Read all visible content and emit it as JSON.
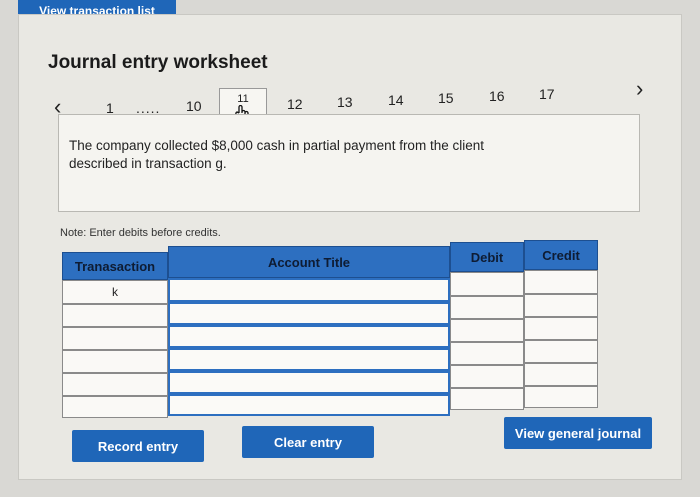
{
  "top_button": "View transaction list",
  "title": "Journal entry worksheet",
  "nav": {
    "prev_icon": "chevron-left-icon",
    "next_icon": "chevron-right-icon",
    "items": [
      "1",
      ".....",
      "10",
      "11",
      "12",
      "13",
      "14",
      "15",
      "16",
      "17"
    ],
    "selected": "11"
  },
  "description": "The company collected $8,000 cash in partial payment from the client described in transaction g.",
  "note": "Note: Enter debits before credits.",
  "table": {
    "headers": {
      "transaction": "Tranasaction",
      "account": "Account Title",
      "debit": "Debit",
      "credit": "Credit"
    },
    "rows": [
      {
        "transaction": "k",
        "account": "",
        "debit": "",
        "credit": ""
      },
      {
        "transaction": "",
        "account": "",
        "debit": "",
        "credit": ""
      },
      {
        "transaction": "",
        "account": "",
        "debit": "",
        "credit": ""
      },
      {
        "transaction": "",
        "account": "",
        "debit": "",
        "credit": ""
      },
      {
        "transaction": "",
        "account": "",
        "debit": "",
        "credit": ""
      },
      {
        "transaction": "",
        "account": "",
        "debit": "",
        "credit": ""
      }
    ]
  },
  "buttons": {
    "record": "Record entry",
    "clear": "Clear entry",
    "general_journal": "View general journal"
  },
  "colors": {
    "primary": "#1f66b8",
    "header": "#2d6fc0"
  }
}
